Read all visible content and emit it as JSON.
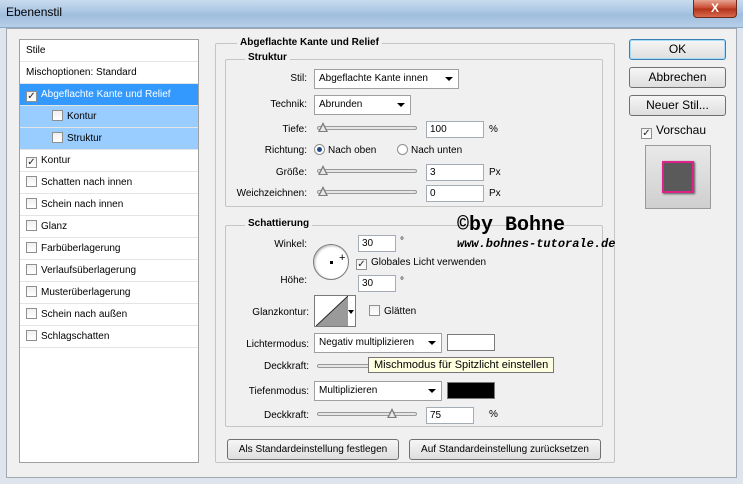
{
  "window": {
    "title": "Ebenenstil",
    "close": "X"
  },
  "stylelist": {
    "header": "Stile",
    "items": [
      {
        "label": "Mischoptionen: Standard",
        "check": false,
        "checked": false
      },
      {
        "label": "Abgeflachte Kante und Relief",
        "check": true,
        "checked": true
      },
      {
        "label": "Kontur",
        "check": true,
        "checked": false
      },
      {
        "label": "Struktur",
        "check": true,
        "checked": false
      },
      {
        "label": "Kontur",
        "check": true,
        "checked": true
      },
      {
        "label": "Schatten nach innen",
        "check": true,
        "checked": false
      },
      {
        "label": "Schein nach innen",
        "check": true,
        "checked": false
      },
      {
        "label": "Glanz",
        "check": true,
        "checked": false
      },
      {
        "label": "Farbüberlagerung",
        "check": true,
        "checked": false
      },
      {
        "label": "Verlaufsüberlagerung",
        "check": true,
        "checked": false
      },
      {
        "label": "Musterüberlagerung",
        "check": true,
        "checked": false
      },
      {
        "label": "Schein nach außen",
        "check": true,
        "checked": false
      },
      {
        "label": "Schlagschatten",
        "check": true,
        "checked": false
      }
    ]
  },
  "bevel": {
    "title": "Abgeflachte Kante und Relief",
    "struktur_title": "Struktur",
    "stil_label": "Stil:",
    "stil_value": "Abgeflachte Kante innen",
    "technik_label": "Technik:",
    "technik_value": "Abrunden",
    "tiefe_label": "Tiefe:",
    "tiefe_value": "100",
    "tiefe_unit": "%",
    "tiefe_level": 0.0,
    "richtung_label": "Richtung:",
    "richtung_up": "Nach oben",
    "richtung_down": "Nach unten",
    "groesse_label": "Größe:",
    "groesse_value": "3",
    "groesse_unit": "Px",
    "groesse_level": 0.0,
    "weich_label": "Weichzeichnen:",
    "weich_value": "0",
    "weich_unit": "Px",
    "weich_level": 0.0
  },
  "shading": {
    "title": "Schattierung",
    "winkel_label": "Winkel:",
    "winkel_value": "30",
    "winkel_unit": "°",
    "global_light": "Globales Licht verwenden",
    "hoehe_label": "Höhe:",
    "hoehe_value": "30",
    "hoehe_unit": "°",
    "glanzkontur_label": "Glanzkontur:",
    "glaetten": "Glätten",
    "lichter_label": "Lichtermodus:",
    "lichter_value": "Negativ multiplizieren",
    "lichter_color": "#ffffff",
    "deckkraft1_label": "Deckkraft:",
    "tiefen_label": "Tiefenmodus:",
    "tiefen_value": "Multiplizieren",
    "tiefen_color": "#000000",
    "deckkraft2_label": "Deckkraft:",
    "deckkraft2_value": "75",
    "deckkraft2_unit": "%",
    "deckkraft2_level": 0.75
  },
  "tooltip": "Mischmodus für Spitzlicht einstellen",
  "watermark": {
    "line1": "©by Bohne",
    "line2": "www.bohnes-tutorale.de"
  },
  "buttons": {
    "set_default": "Als Standardeinstellung festlegen",
    "reset_default": "Auf Standardeinstellung zurücksetzen",
    "ok": "OK",
    "cancel": "Abbrechen",
    "new_style": "Neuer Stil...",
    "preview": "Vorschau"
  },
  "colors": {
    "selection": "#3399ff",
    "subselection": "#99ccff",
    "preview_border": "#e0218a",
    "preview_fill": "#5a5a5a"
  }
}
